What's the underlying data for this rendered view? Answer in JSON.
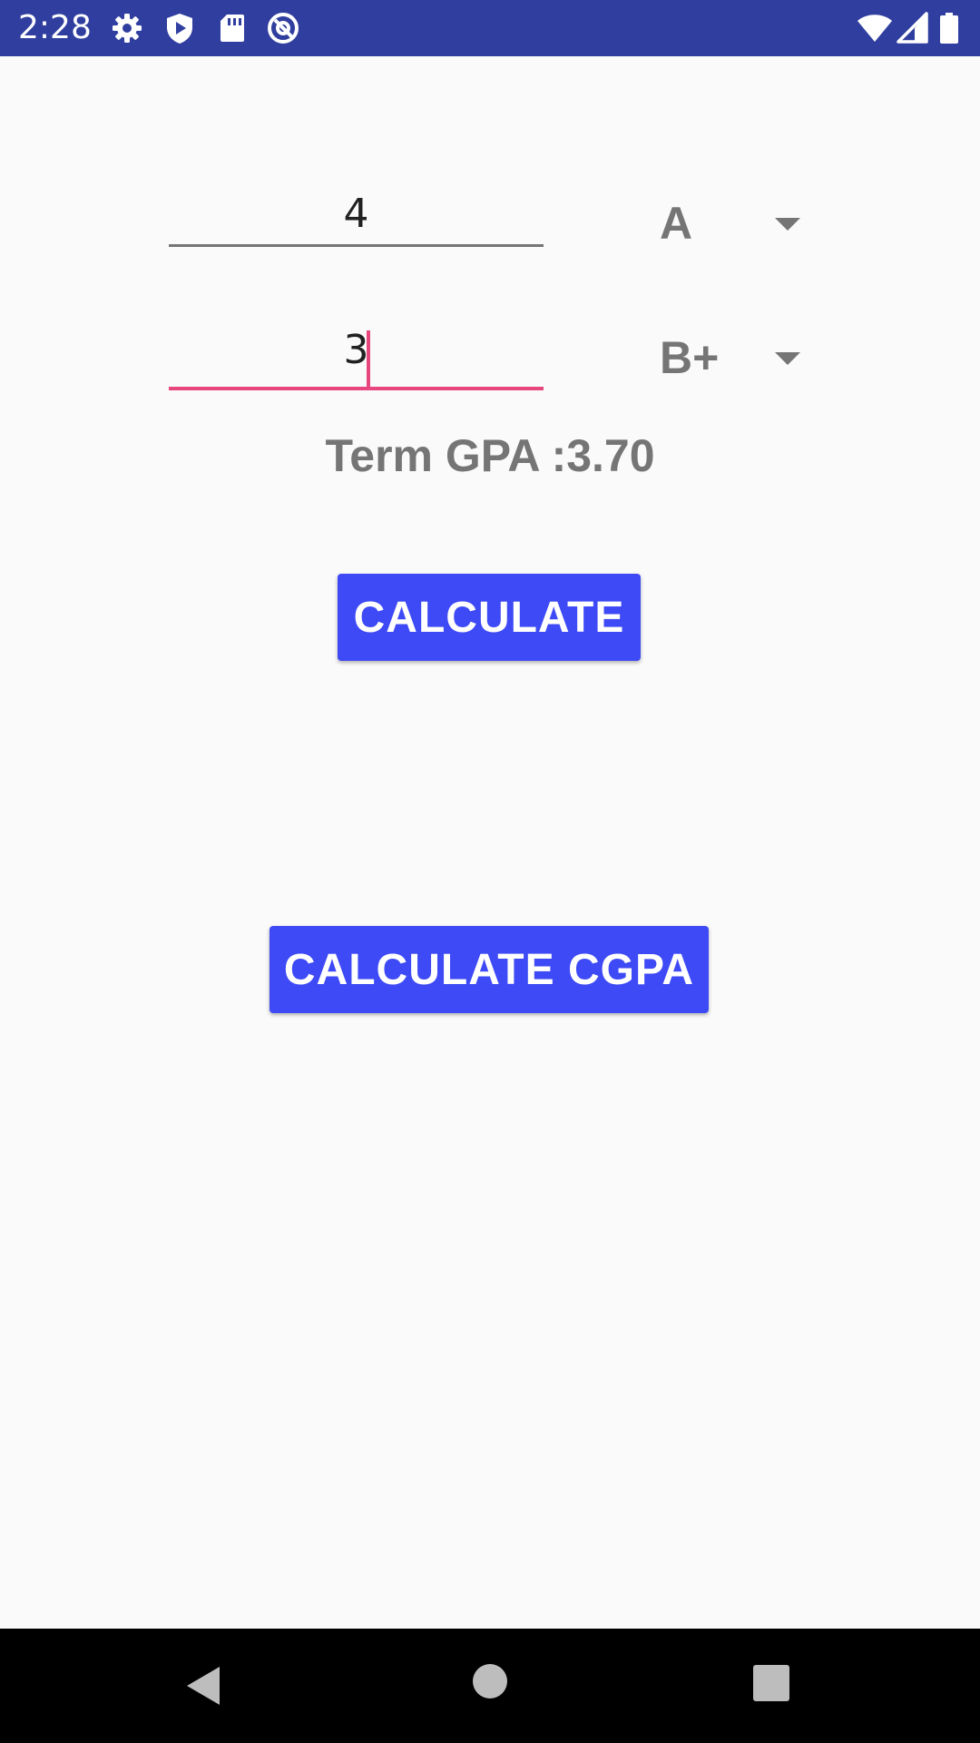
{
  "status_bar": {
    "time": "2:28",
    "icons_left": [
      "gear-icon",
      "play-protect-icon",
      "sd-card-icon",
      "at-sign-icon"
    ],
    "icons_right": [
      "wifi-icon",
      "cell-signal-icon",
      "battery-icon"
    ],
    "background_color": "#303f9f"
  },
  "courses": [
    {
      "credit": "4",
      "grade": "A",
      "focused": false
    },
    {
      "credit": "3",
      "grade": "B+",
      "focused": true
    }
  ],
  "term_gpa_text": "Term GPA :3.70",
  "buttons": {
    "calculate": "CALCULATE",
    "calculate_cgpa": "CALCULATE CGPA"
  },
  "colors": {
    "accent": "#e8467f",
    "button": "#3d4af5",
    "text_muted": "#757575"
  },
  "nav_bar": {
    "icons": [
      "back-icon",
      "home-icon",
      "recents-icon"
    ]
  }
}
